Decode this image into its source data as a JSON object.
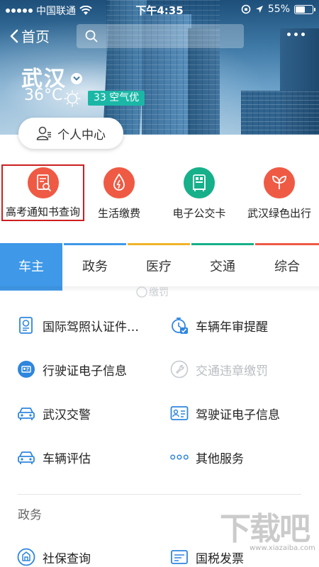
{
  "status_bar": {
    "carrier": "中国联通",
    "time": "下午4:35",
    "battery": "55%"
  },
  "nav": {
    "back_label": "首页",
    "search_placeholder": ""
  },
  "weather": {
    "city": "武汉",
    "temperature": "36°C",
    "aqi": "33 空气优"
  },
  "personal_center": "个人中心",
  "services": [
    {
      "label": "高考通知书查询",
      "icon": "document-search-icon",
      "color": "#ef5a44"
    },
    {
      "label": "生活缴费",
      "icon": "water-drop-icon",
      "color": "#ef5a44"
    },
    {
      "label": "电子公交卡",
      "icon": "bus-card-icon",
      "color": "#16b08a"
    },
    {
      "label": "武汉绿色出行",
      "icon": "leaf-icon",
      "color": "#ef5a44"
    }
  ],
  "tabs": [
    {
      "label": "车主",
      "active": true,
      "line_color": "#3f98e8"
    },
    {
      "label": "政务",
      "active": false,
      "line_color": "#3f98e8"
    },
    {
      "label": "医疗",
      "active": false,
      "line_color": "#f0b429"
    },
    {
      "label": "交通",
      "active": false,
      "line_color": "#16b08a"
    },
    {
      "label": "综合",
      "active": false,
      "line_color": "#ef5a44"
    }
  ],
  "ghost_text": "缴罚",
  "car_services": [
    {
      "label": "国际驾照认证件…",
      "icon": "license-doc-icon"
    },
    {
      "label": "车辆年审提醒",
      "icon": "stopwatch-check-icon"
    },
    {
      "label": "行驶证电子信息",
      "icon": "id-card-circle-icon"
    },
    {
      "label": "交通违章缴罚",
      "icon": "wrench-icon",
      "disabled": true
    },
    {
      "label": "武汉交警",
      "icon": "car-icon"
    },
    {
      "label": "驾驶证电子信息",
      "icon": "id-card-icon"
    },
    {
      "label": "车辆评估",
      "icon": "car-icon"
    },
    {
      "label": "其他服务",
      "icon": "more-dots-icon"
    }
  ],
  "sections": {
    "government": "政务"
  },
  "gov_services": [
    {
      "label": "社保查询",
      "icon": "social-security-icon"
    },
    {
      "label": "国税发票",
      "icon": "tax-icon"
    }
  ],
  "watermark": {
    "logo": "下载吧",
    "url": "www.xiazaiba.com"
  },
  "colors": {
    "accent": "#3f98e8",
    "red": "#ef5a44",
    "green": "#16b08a",
    "aqi": "#1bb7a6",
    "highlight_border": "#cc1f1f"
  }
}
